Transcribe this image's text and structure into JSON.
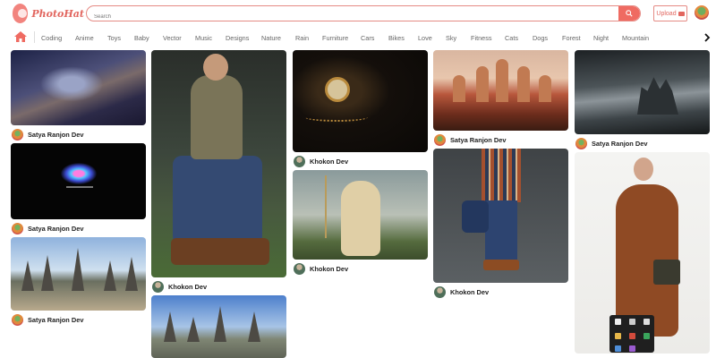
{
  "app": {
    "logo_text": "PhotoHat",
    "search_placeholder": "Search",
    "upload_label": "Upload"
  },
  "categories": [
    "Coding",
    "Anime",
    "Toys",
    "Baby",
    "Vector",
    "Music",
    "Designs",
    "Nature",
    "Rain",
    "Furniture",
    "Cars",
    "Bikes",
    "Love",
    "Sky",
    "Fitness",
    "Cats",
    "Dogs",
    "Forest",
    "Night",
    "Mountain"
  ],
  "feed": {
    "col1": [
      {
        "user": "Satya Ranjon Dev"
      },
      {
        "user": "Satya Ranjon Dev"
      },
      {
        "user": "Satya Ranjon Dev"
      }
    ],
    "col2": [
      {
        "user": "Khokon Dev"
      }
    ],
    "col3": [
      {
        "user": "Khokon Dev"
      },
      {
        "user": "Khokon Dev"
      }
    ],
    "col4": [
      {
        "user": "Satya Ranjon Dev"
      },
      {
        "user": "Khokon Dev"
      }
    ],
    "col5": [
      {
        "user": "Satya Ranjon Dev"
      }
    ]
  },
  "colors": {
    "accent": "#ef6b62",
    "accent_border": "#e58a84"
  },
  "icons": [
    "logo-icon",
    "search-icon",
    "camera-icon",
    "home-icon",
    "chevron-right-icon"
  ]
}
